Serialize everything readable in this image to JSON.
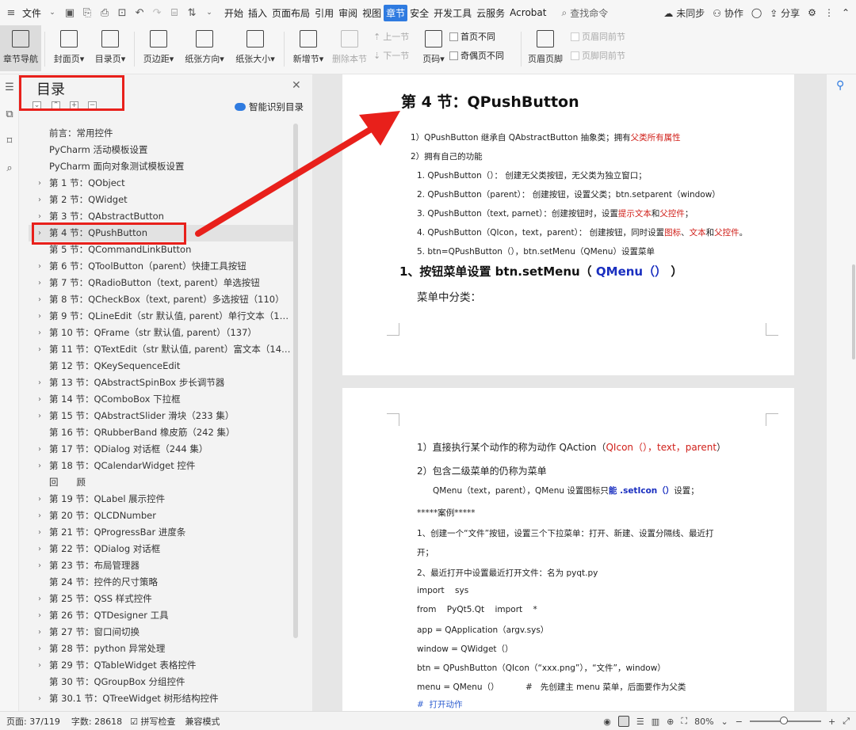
{
  "menubar": {
    "file_label": "文件",
    "tabs": [
      {
        "label": "开始"
      },
      {
        "label": "插入"
      },
      {
        "label": "页面布局"
      },
      {
        "label": "引用"
      },
      {
        "label": "审阅"
      },
      {
        "label": "视图"
      },
      {
        "label": "章节",
        "active": true
      },
      {
        "label": "安全"
      },
      {
        "label": "开发工具"
      },
      {
        "label": "云服务"
      },
      {
        "label": "Acrobat"
      }
    ],
    "search_label": "查找命令",
    "right": {
      "sync": "未同步",
      "collab": "协作",
      "share": "分享"
    }
  },
  "ribbon": {
    "buttons": [
      {
        "label": "章节导航",
        "active": true
      },
      {
        "label": "封面页",
        "dropdown": true
      },
      {
        "label": "目录页",
        "dropdown": true
      },
      {
        "label": "页边距",
        "dropdown": true
      },
      {
        "label": "纸张方向",
        "dropdown": true
      },
      {
        "label": "纸张大小",
        "dropdown": true
      },
      {
        "label": "新增节",
        "dropdown": true
      },
      {
        "label": "删除本节",
        "disabled": true
      }
    ],
    "nav": {
      "prev": "上一节",
      "next": "下一节"
    },
    "pagenum": {
      "label": "页码",
      "dropdown": true
    },
    "checks": {
      "first_diff": "首页不同",
      "odd_even_diff": "奇偶页不同"
    },
    "header_footer": "页眉页脚",
    "same_as_prev": {
      "header": "页眉同前节",
      "footer": "页脚同前节"
    }
  },
  "toc": {
    "title": "目录",
    "smart_label": "智能识别目录",
    "items": [
      {
        "text": "前言：常用控件",
        "chevron": false
      },
      {
        "text": "PyCharm 活动模板设置",
        "chevron": false
      },
      {
        "text": "PyCharm 面向对象测试模板设置",
        "chevron": false
      },
      {
        "text": "第 1 节：QObject",
        "chevron": true
      },
      {
        "text": "第 2 节：QWidget",
        "chevron": true
      },
      {
        "text": "第 3 节：QAbstractButton",
        "chevron": true
      },
      {
        "text": "第 4 节：QPushButton",
        "chevron": true,
        "selected": true
      },
      {
        "text": "第 5 节：QCommandLinkButton",
        "chevron": false
      },
      {
        "text": "第 6 节：QToolButton（parent）快捷工具按钮",
        "chevron": true
      },
      {
        "text": "第 7 节：QRadioButton（text, parent）单选按钮",
        "chevron": true
      },
      {
        "text": "第 8 节：QCheckBox（text, parent）多选按钮（110）",
        "chevron": true
      },
      {
        "text": "第 9 节：QLineEdit（str 默认值, parent）单行文本（11...",
        "chevron": true
      },
      {
        "text": "第 10 节：QFrame（str 默认值, parent）（137）",
        "chevron": true
      },
      {
        "text": "第 11 节：QTextEdit（str 默认值, parent）富文本（140...",
        "chevron": true
      },
      {
        "text": "第 12 节：QKeySequenceEdit",
        "chevron": false
      },
      {
        "text": "第 13 节：QAbstractSpinBox 步长调节器",
        "chevron": true
      },
      {
        "text": "第 14 节：QComboBox 下拉框",
        "chevron": true
      },
      {
        "text": "第 15 节：QAbstractSlider 滑块（233 集）",
        "chevron": true
      },
      {
        "text": "第 16 节：QRubberBand 橡皮筋（242 集）",
        "chevron": false
      },
      {
        "text": "第 17 节：QDialog 对话框（244 集）",
        "chevron": true
      },
      {
        "text": "第 18 节：QCalendarWidget 控件",
        "chevron": true
      },
      {
        "text": "回　　顾",
        "chevron": false
      },
      {
        "text": "第 19 节：QLabel 展示控件",
        "chevron": true
      },
      {
        "text": "第 20 节：QLCDNumber",
        "chevron": true
      },
      {
        "text": "第 21 节：QProgressBar 进度条",
        "chevron": true
      },
      {
        "text": "第 22 节：QDialog 对话框",
        "chevron": true
      },
      {
        "text": "第 23 节：布局管理器",
        "chevron": true
      },
      {
        "text": "第 24 节：控件的尺寸策略",
        "chevron": false
      },
      {
        "text": "第 25 节：QSS 样式控件",
        "chevron": true
      },
      {
        "text": "第 26 节：QTDesigner 工具",
        "chevron": true
      },
      {
        "text": "第 27 节：窗口间切换",
        "chevron": true
      },
      {
        "text": "第 28 节：python 异常处理",
        "chevron": true
      },
      {
        "text": "第 29 节：QTableWidget 表格控件",
        "chevron": true
      },
      {
        "text": "第 30 节：QGroupBox 分组控件",
        "chevron": false
      },
      {
        "text": "第 30.1 节：QTreeWidget 树形结构控件",
        "chevron": true
      }
    ]
  },
  "doc": {
    "page1": {
      "title": "第 4 节：QPushButton",
      "l1_a": "1）QPushButton 继承自 QAbstractButton 抽象类；拥有",
      "l1_b": "父类所有属性",
      "l2": "2）拥有自己的功能",
      "l3": "1. QPushButton（）：  创建无父类按钮，无父类为独立窗口；",
      "l4": "2. QPushButton（parent）：  创建按钮，设置父类；btn.setparent（window）",
      "l5_a": "3. QPushButton（text, parnet）：创建按钮时，设置",
      "l5_b": "提示文本",
      "l5_c": "和",
      "l5_d": "父控件",
      "l5_e": "；",
      "l6_a": "4. QPushButton（QIcon，text，parent）：  创建按钮，同时设置",
      "l6_b": "图标",
      "l6_c": "、",
      "l6_d": "文本",
      "l6_e": "和",
      "l6_f": "父控件",
      "l6_g": "。",
      "l7": "5. btn=QPushButton（），btn.setMenu（QMenu）设置菜单",
      "h2_a": "1、按钮菜单设置 btn.setMenu（ ",
      "h2_b": "QMenu（）",
      "h2_c": " ）",
      "p14": "菜单中分类："
    },
    "page2": {
      "l1_a": "1）直接执行某个动作的称为动作 QAction（",
      "l1_b": "QIcon（），text，parent",
      "l1_c": "）",
      "l2": "2）包含二级菜单的仍称为菜单",
      "l3_a": "QMenu（text，parent），QMenu 设置图标只",
      "l3_b": "能 .setIcon（）",
      "l3_c": "设置；",
      "l4": "*****案例*****",
      "l5": "1、创建一个“文件”按钮，设置三个下拉菜单：打开、新建、设置分隔线、最近打",
      "l6": "开；",
      "l7": "2、最近打开中设置最近打开文件：名为 pyqt.py",
      "code1": "import    sys",
      "code2": "from    PyQt5.Qt    import    *",
      "code3": "app = QApplication（argv.sys）",
      "code4": "window = QWidget（）",
      "code5": "btn = QPushButton（QIcon（“xxx.png”），“文件”，window）",
      "code6": "menu = QMenu（）          #   先创建主 menu 菜单，后面要作为父类",
      "code7": "#  打开动作"
    }
  },
  "statusbar": {
    "page": "页面: 37/119",
    "words": "字数: 28618",
    "spell": "拼写检查",
    "compat": "兼容模式",
    "zoom": "80%",
    "zoom_fraction": 0.47
  },
  "colors": {
    "accent": "#2f7be0",
    "annotation": "#e8201b",
    "doc_red": "#d0201a",
    "doc_blue": "#1a2fc0"
  }
}
